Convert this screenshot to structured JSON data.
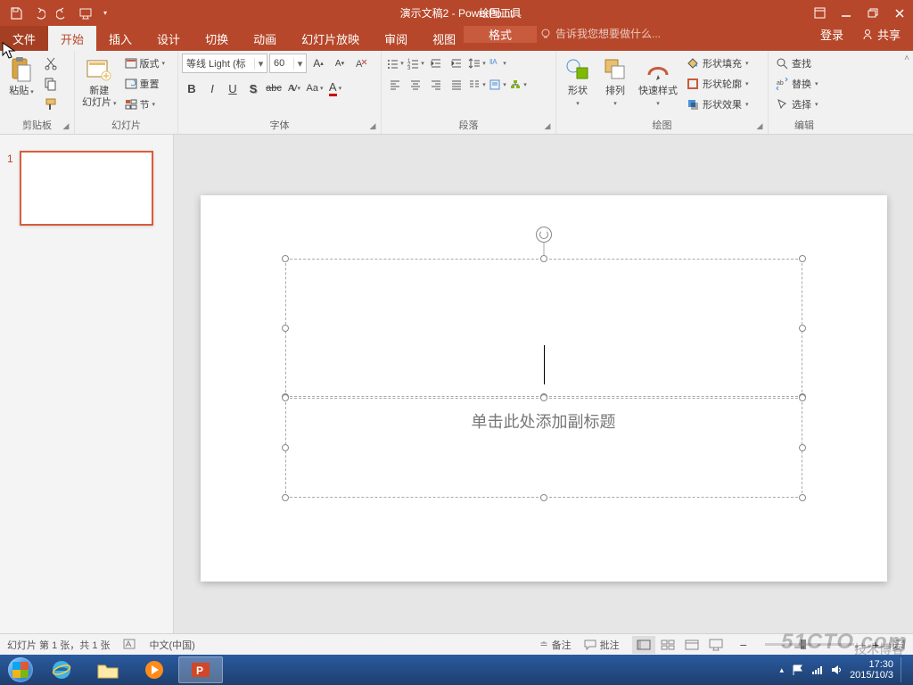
{
  "title": {
    "doc": "演示文稿2 - PowerPoint",
    "contextual": "绘图工具"
  },
  "tabs": {
    "file": "文件",
    "home": "开始",
    "insert": "插入",
    "design": "设计",
    "transitions": "切换",
    "animations": "动画",
    "slideshow": "幻灯片放映",
    "review": "审阅",
    "view": "视图",
    "format": "格式",
    "tellme": "告诉我您想要做什么...",
    "login": "登录",
    "share": "共享"
  },
  "ribbon": {
    "clipboard": {
      "label": "剪贴板",
      "paste": "粘贴"
    },
    "slides": {
      "label": "幻灯片",
      "new": "新建\n幻灯片",
      "layout": "版式",
      "reset": "重置",
      "section": "节"
    },
    "font": {
      "label": "字体",
      "name": "等线 Light (标",
      "size": "60"
    },
    "paragraph": {
      "label": "段落"
    },
    "drawing": {
      "label": "绘图",
      "shapes": "形状",
      "arrange": "排列",
      "quick": "快速样式",
      "fill": "形状填充",
      "outline": "形状轮廓",
      "effects": "形状效果"
    },
    "editing": {
      "label": "编辑",
      "find": "查找",
      "replace": "替换",
      "select": "选择"
    }
  },
  "slide": {
    "number": "1",
    "subtitle": "单击此处添加副标题"
  },
  "status": {
    "slideinfo": "幻灯片 第 1 张，共 1 张",
    "lang": "中文(中国)",
    "notes": "备注",
    "comments": "批注"
  },
  "tray": {
    "time": "17:30",
    "date": "2015/10/3"
  },
  "watermark": "51CTO.com",
  "watermark2": "技术博客"
}
